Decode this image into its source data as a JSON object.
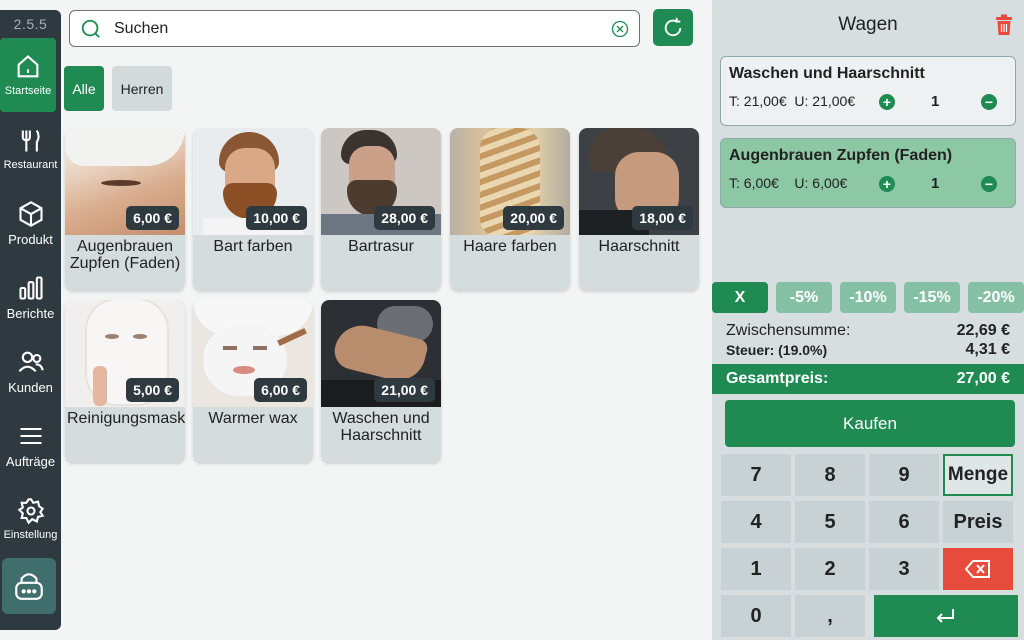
{
  "app": {
    "version": "2.5.5"
  },
  "sidebar": {
    "items": [
      {
        "label": "Startseite",
        "icon": "home-icon",
        "active": true
      },
      {
        "label": "Restaurant",
        "icon": "fork-knife-icon"
      },
      {
        "label": "Produkt",
        "icon": "box-icon"
      },
      {
        "label": "Berichte",
        "icon": "bar-chart-icon"
      },
      {
        "label": "Kunden",
        "icon": "users-icon"
      },
      {
        "label": "Aufträge",
        "icon": "menu-icon"
      },
      {
        "label": "Einstellung",
        "icon": "gear-icon"
      }
    ],
    "lock_icon": "lock-icon"
  },
  "search": {
    "placeholder": "Suchen"
  },
  "filters": [
    {
      "label": "Alle",
      "active": true
    },
    {
      "label": "Herren",
      "active": false
    }
  ],
  "products": [
    {
      "name": "Augenbrauen Zupfen (Faden)",
      "price": "6,00 €"
    },
    {
      "name": "Bart farben",
      "price": "10,00 €"
    },
    {
      "name": "Bartrasur",
      "price": "28,00 €"
    },
    {
      "name": "Haare farben",
      "price": "20,00 €"
    },
    {
      "name": "Haarschnitt",
      "price": "18,00 €"
    },
    {
      "name": "Reinigungsmasken",
      "price": "5,00 €"
    },
    {
      "name": "Warmer wax",
      "price": "6,00 €"
    },
    {
      "name": "Waschen und Haarschnitt",
      "price": "21,00 €"
    }
  ],
  "cart": {
    "title": "Wagen",
    "items": [
      {
        "name": "Waschen und Haarschnitt",
        "t_price": "T: 21,00€",
        "u_price": "U: 21,00€",
        "qty": "1"
      },
      {
        "name": "Augenbrauen Zupfen (Faden)",
        "t_price": "T: 6,00€",
        "u_price": "U: 6,00€",
        "qty": "1"
      }
    ],
    "discounts": [
      "X",
      "-5%",
      "-10%",
      "-15%",
      "-20%"
    ],
    "subtotal_label": "Zwischensumme:",
    "subtotal_value": "22,69 €",
    "tax_label": "Steuer: (19.0%)",
    "tax_value": "4,31 €",
    "total_label": "Gesamtpreis:",
    "total_value": "27,00 €",
    "buy_label": "Kaufen"
  },
  "keypad": {
    "keys": [
      "7",
      "8",
      "9",
      "Menge",
      "4",
      "5",
      "6",
      "Preis",
      "1",
      "2",
      "3",
      "0",
      ","
    ]
  },
  "colors": {
    "primary": "#1f8a52",
    "sidebar": "#2f3a40",
    "danger": "#e74b3c"
  }
}
